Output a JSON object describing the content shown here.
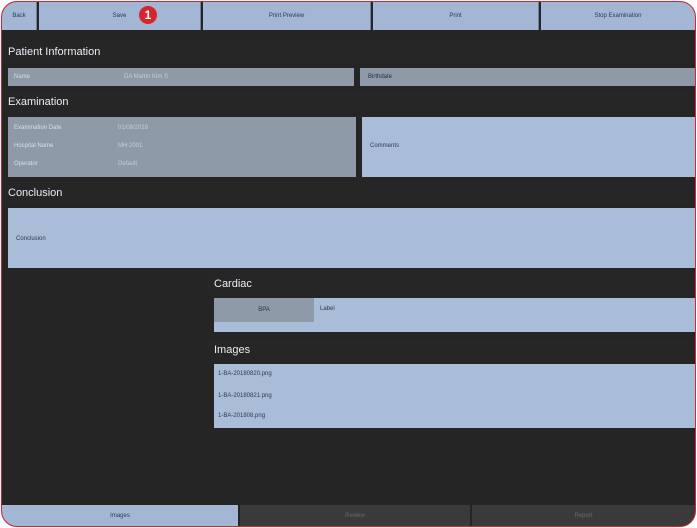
{
  "toolbar": {
    "back_label": "Back",
    "save_label": "Save",
    "print_preview_label": "Print Preview",
    "print_label": "Print",
    "stop_label": "Stop Examination"
  },
  "callout": {
    "number": "1"
  },
  "patient": {
    "header": "Patient Information",
    "name_label": "Name",
    "name_value": "DA Martin Kim S",
    "birthdate_label": "Birthdate"
  },
  "exam": {
    "header": "Examination",
    "rows": [
      {
        "label": "Examination Date",
        "value": "01/08/2018"
      },
      {
        "label": "Hospital Name",
        "value": "MH 2001"
      },
      {
        "label": "Operator",
        "value": "Default"
      }
    ],
    "comments_label": "Comments"
  },
  "conclusion": {
    "header": "Conclusion",
    "field_label": "Conclusion"
  },
  "cardiac": {
    "header": "Cardiac",
    "tab_label": "BPA",
    "value": "Label"
  },
  "images": {
    "header": "Images",
    "files": [
      "1-BA-20180820.png",
      "1-BA-20180821.png",
      "1-BA-201808.png"
    ]
  },
  "bottom_tabs": [
    {
      "label": "Images"
    },
    {
      "label": "Review"
    },
    {
      "label": "Report"
    }
  ],
  "colors": {
    "accent": "#d9242b",
    "panel_blue": "#a9bcd8",
    "panel_grey": "#8e9aa8",
    "background": "#252525"
  }
}
